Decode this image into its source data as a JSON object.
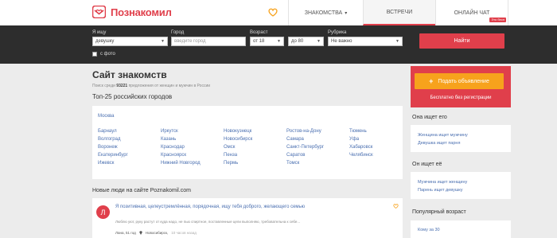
{
  "header": {
    "logo_text": "Познакомил",
    "nav": [
      {
        "label": "ЗНАКОМСТВА",
        "caret": "▾"
      },
      {
        "label": "ВСТРЕЧИ"
      },
      {
        "label": "ОНЛАЙН ЧАТ",
        "badge": "Это бесп"
      }
    ]
  },
  "search": {
    "seeking": {
      "label": "Я ищу",
      "value": "девушку"
    },
    "city": {
      "label": "Город",
      "placeholder": "введите город"
    },
    "age": {
      "label": "Возраст",
      "from": "от 18",
      "to": "до 80"
    },
    "category": {
      "label": "Рубрика",
      "value": "Не важно"
    },
    "photo_label": "с фото",
    "find_button": "Найти"
  },
  "main": {
    "title": "Сайт знакомств",
    "subtitle_prefix": "Поиск среди",
    "subtitle_count": "93221",
    "subtitle_suffix": "предложения от женщин и мужчин в России",
    "cities_title": "Топ-25 российских городов",
    "cities": {
      "featured": "Москва",
      "col1": [
        "Барнаул",
        "Волгоград",
        "Воронеж",
        "Екатеринбург",
        "Ижевск"
      ],
      "col2": [
        "Иркутск",
        "Казань",
        "Краснодар",
        "Красноярск",
        "Нижний Новгород"
      ],
      "col3": [
        "Новокузнецк",
        "Новосибирск",
        "Омск",
        "Пенза",
        "Пермь"
      ],
      "col4": [
        "Ростов-на-Дону",
        "Самара",
        "Санкт-Петербург",
        "Саратов",
        "Томск"
      ],
      "col5": [
        "Тюмень",
        "Уфа",
        "Хабаровск",
        "Челябинск"
      ]
    },
    "new_people_title": "Новые люди на сайте Poznakomil.com",
    "profile": {
      "initial": "Л",
      "title": "Я позитивная, целеустремлённая, порядочная, ищу тебя доброго, желающего семью",
      "text": "Люблю уют, руку растут от куда надо, не пью спиртное, поставленные цели выполняю, требовательна к себе...",
      "name_age": "Лана, 51 год",
      "city": "Новосибирск,",
      "time": "10 часов назад"
    }
  },
  "sidebar": {
    "add_button": "Подать объявление",
    "add_plus": "+",
    "free_text": "Бесплатно без регистрации",
    "she_seeks": {
      "title": "Она ищет его",
      "links": [
        "Женщина ищет мужчину",
        "Девушка ищет парня"
      ]
    },
    "he_seeks": {
      "title": "Он ищет её",
      "links": [
        "Мужчина ищет женщину",
        "Парень ищет девушку"
      ]
    },
    "popular_age": {
      "title": "Популярный возраст",
      "links": [
        "Кому за 30"
      ]
    }
  },
  "colors": {
    "brand": "#e03f4b",
    "accent": "#f7a21c",
    "link": "#4a6fb0",
    "bar": "#2d2d2d"
  }
}
